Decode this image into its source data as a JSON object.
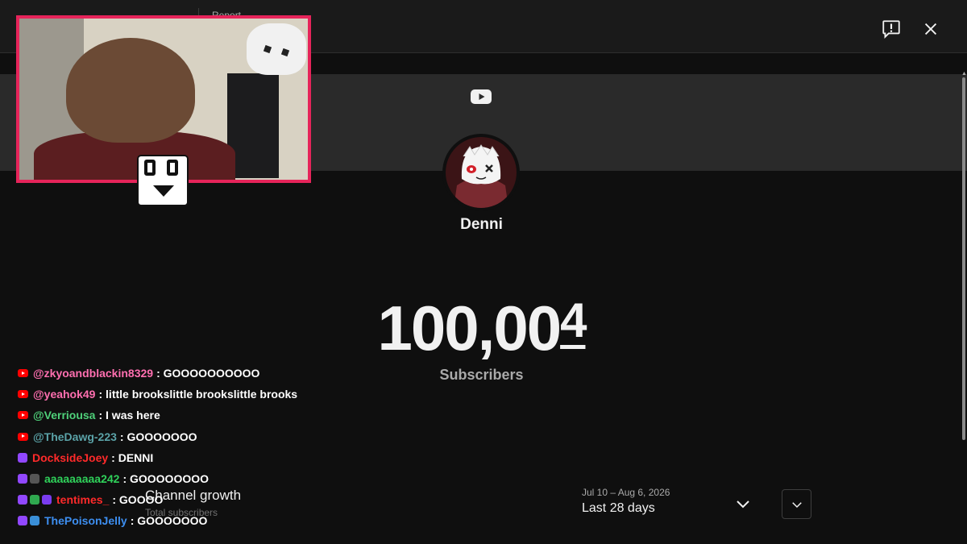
{
  "top_bar": {
    "label": "Report"
  },
  "channel": {
    "name": "Denni"
  },
  "counter": {
    "main": "100,00",
    "rolling_digit": "4",
    "label": "Subscribers"
  },
  "growth": {
    "title": "Channel growth",
    "subtitle": "Total subscribers"
  },
  "date": {
    "range": "Jul 10 – Aug 6, 2026",
    "label": "Last 28 days"
  },
  "colors": {
    "accent_webcam_border": "#e6245a",
    "youtube_red": "#ff0000",
    "twitch_purple": "#9147ff"
  },
  "icons": [
    "feedback-icon",
    "close-icon",
    "youtube-logo-icon",
    "chevron-down-icon",
    "expand-icon"
  ],
  "chat": [
    {
      "platform": "youtube",
      "badges": [
        "yt"
      ],
      "name": "@zkyoandblackin8329",
      "name_color": "#ff6fb0",
      "message": ": GOOOOOOOOOO"
    },
    {
      "platform": "youtube",
      "badges": [
        "yt"
      ],
      "name": "@yeahok49",
      "name_color": "#ff6fb0",
      "message": ": little brookslittle brookslittle brooks"
    },
    {
      "platform": "youtube",
      "badges": [
        "yt"
      ],
      "name": "@Verriousa",
      "name_color": "#4fd17a",
      "message": ": I was here"
    },
    {
      "platform": "youtube",
      "badges": [
        "yt"
      ],
      "name": "@TheDawg-223",
      "name_color": "#5ba3a8",
      "message": ": GOOOOOOO"
    },
    {
      "platform": "twitch",
      "badges": [
        "tw"
      ],
      "name": "DocksideJoey",
      "name_color": "#ff2a2a",
      "message": ": DENNI"
    },
    {
      "platform": "twitch",
      "badges": [
        "tw",
        "gray"
      ],
      "name": "aaaaaaaaa242",
      "name_color": "#2fd15a",
      "message": ": GOOOOOOOO"
    },
    {
      "platform": "twitch",
      "badges": [
        "tw",
        "green",
        "purple"
      ],
      "name": "tentimes_",
      "name_color": "#ff2a2a",
      "message": ": GOOOO"
    },
    {
      "platform": "twitch",
      "badges": [
        "tw",
        "blue"
      ],
      "name": "ThePoisonJelly",
      "name_color": "#3d8ef0",
      "message": ": GOOOOOOO"
    }
  ]
}
